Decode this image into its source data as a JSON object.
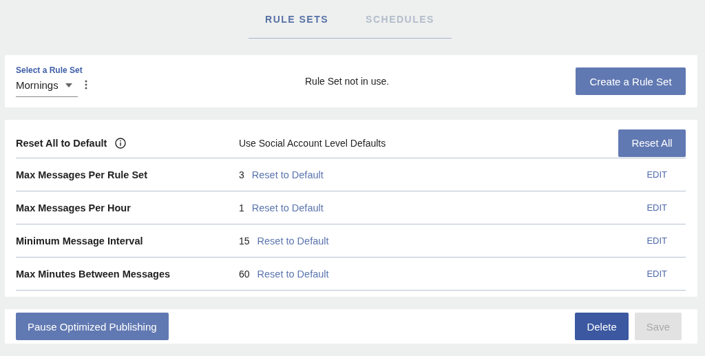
{
  "tabs": [
    {
      "label": "RULE SETS",
      "selected": true
    },
    {
      "label": "SCHEDULES",
      "selected": false
    }
  ],
  "rule_set_panel": {
    "label": "Select a Rule Set",
    "value": "Mornings",
    "status": "Rule Set not in use.",
    "create_button": "Create a Rule Set"
  },
  "settings": {
    "header": {
      "label": "Reset All to Default",
      "description": "Use Social Account Level Defaults",
      "button": "Reset All"
    },
    "rows": [
      {
        "label": "Max Messages Per Rule Set",
        "value": "3",
        "link": "Reset to Default",
        "action": "EDIT"
      },
      {
        "label": "Max Messages Per Hour",
        "value": "1",
        "link": "Reset to Default",
        "action": "EDIT"
      },
      {
        "label": "Minimum Message Interval",
        "value": "15",
        "link": "Reset to Default",
        "action": "EDIT"
      },
      {
        "label": "Max Minutes Between Messages",
        "value": "60",
        "link": "Reset to Default",
        "action": "EDIT"
      }
    ]
  },
  "footer": {
    "left_buttons": [
      {
        "label": "Pause Optimized Publishing",
        "disabled": false
      }
    ],
    "right_buttons": [
      {
        "label": "Delete",
        "kind": "dark",
        "disabled": false
      },
      {
        "label": "Save",
        "disabled": true
      }
    ]
  }
}
